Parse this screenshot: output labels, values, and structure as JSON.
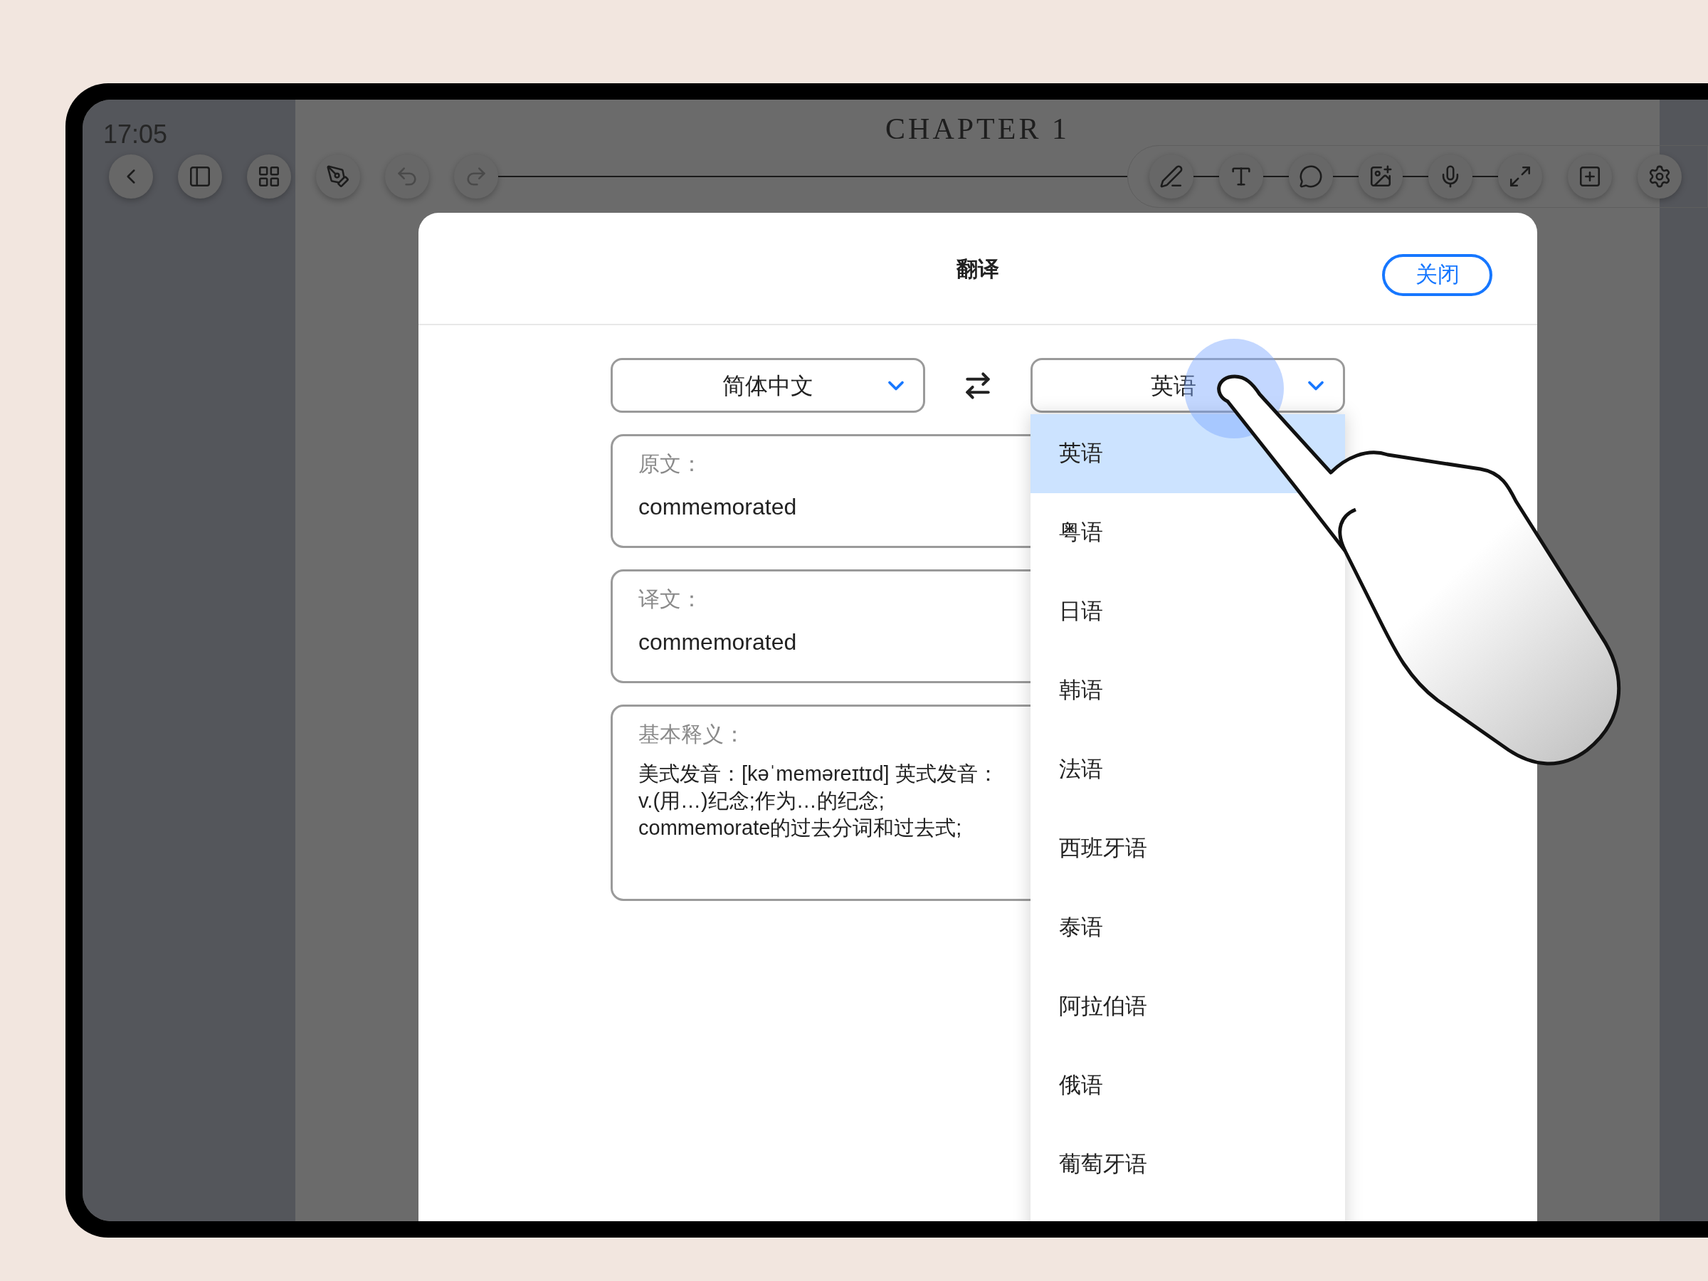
{
  "status_bar": {
    "time": "17:05"
  },
  "document": {
    "title": "CHAPTER 1"
  },
  "dialog": {
    "title": "翻译",
    "close_button": "关闭",
    "source_language": "简体中文",
    "target_language": "英语",
    "sections": [
      {
        "kind": "single",
        "label": "原文：",
        "text": "commemorated"
      },
      {
        "kind": "single",
        "label": "译文：",
        "text": "commemorated"
      },
      {
        "kind": "lines",
        "label": "基本释义：",
        "lines": [
          "美式发音：[kəˈmeməreɪtɪd] 英式发音：",
          "v.(用…)纪念;作为…的纪念;",
          "commemorate的过去分词和过去式;"
        ]
      }
    ],
    "language_menu": [
      {
        "label": "英语",
        "selected": true
      },
      {
        "label": "粤语",
        "selected": false
      },
      {
        "label": "日语",
        "selected": false
      },
      {
        "label": "韩语",
        "selected": false
      },
      {
        "label": "法语",
        "selected": false
      },
      {
        "label": "西班牙语",
        "selected": false
      },
      {
        "label": "泰语",
        "selected": false
      },
      {
        "label": "阿拉伯语",
        "selected": false
      },
      {
        "label": "俄语",
        "selected": false
      },
      {
        "label": "葡萄牙语",
        "selected": false
      }
    ]
  }
}
